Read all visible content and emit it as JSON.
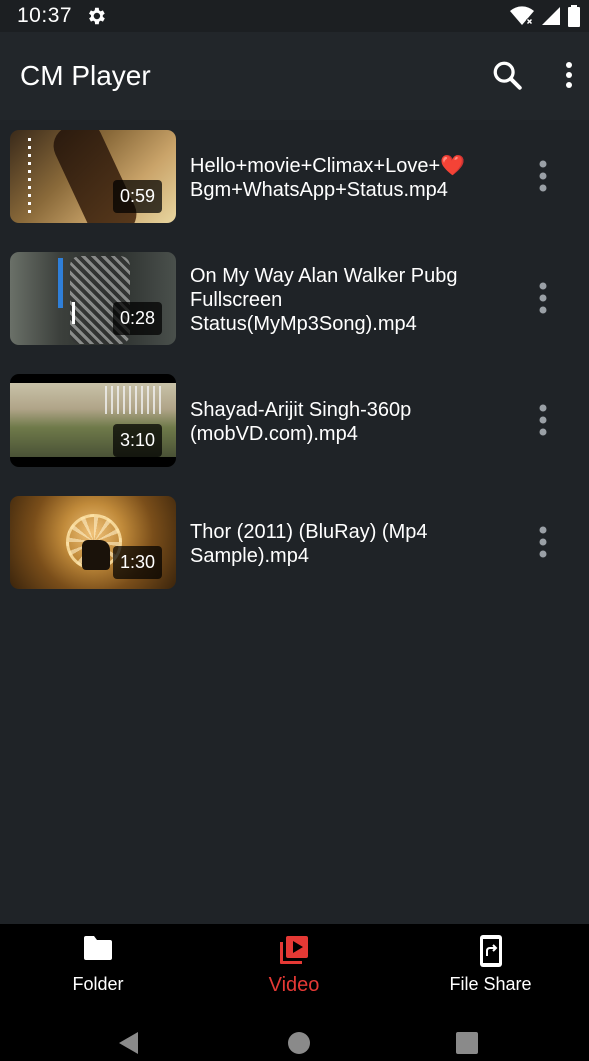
{
  "status_bar": {
    "time": "10:37",
    "icons": [
      "gear-icon",
      "wifi-icon",
      "signal-icon",
      "battery-icon"
    ]
  },
  "app_bar": {
    "title": "CM Player",
    "actions": [
      "search-icon",
      "overflow-menu-icon"
    ]
  },
  "videos": [
    {
      "title": "Hello+movie+Climax+Love+❤️Bgm+WhatsApp+Status.mp4",
      "duration": "0:59"
    },
    {
      "title": "On My Way Alan Walker Pubg Fullscreen Status(MyMp3Song).mp4",
      "duration": "0:28"
    },
    {
      "title": "Shayad-Arijit Singh-360p (mobVD.com).mp4",
      "duration": "3:10"
    },
    {
      "title": "Thor (2011) (BluRay) (Mp4 Sample).mp4",
      "duration": "1:30"
    }
  ],
  "bottom_nav": {
    "items": [
      {
        "label": "Folder",
        "icon": "folder-icon",
        "active": false
      },
      {
        "label": "Video",
        "icon": "video-library-icon",
        "active": true
      },
      {
        "label": "File Share",
        "icon": "file-share-icon",
        "active": false
      }
    ]
  },
  "system_nav": [
    "back-icon",
    "home-icon",
    "recents-icon"
  ],
  "colors": {
    "background": "#1f2327",
    "app_bar": "#22262a",
    "accent": "#e53935",
    "bottom_nav": "#000000"
  }
}
